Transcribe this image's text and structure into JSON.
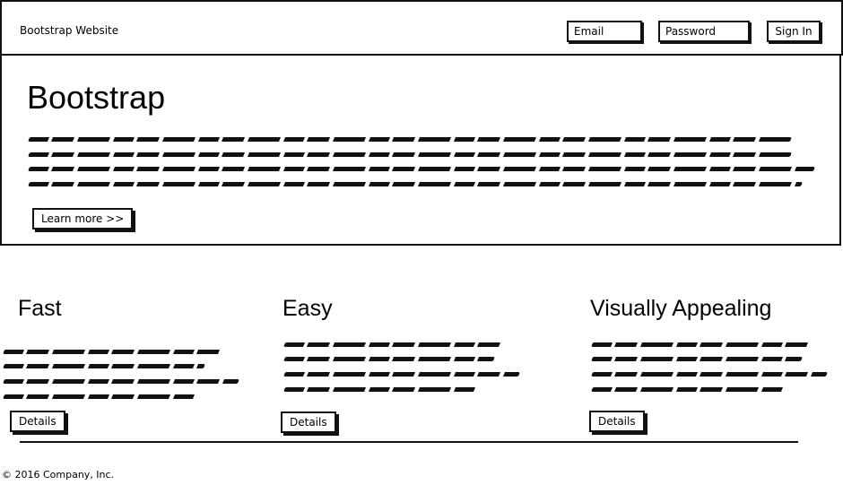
{
  "navbar": {
    "brand": "Bootstrap Website",
    "email_placeholder": "Email",
    "password_placeholder": "Password",
    "sign_in": "Sign In"
  },
  "hero": {
    "title": "Bootstrap",
    "button": "Learn more >>"
  },
  "columns": [
    {
      "title": "Fast",
      "button": "Details"
    },
    {
      "title": "Easy",
      "button": "Details"
    },
    {
      "title": "Visually Appealing",
      "button": "Details"
    }
  ],
  "footer": {
    "copyright": "© 2016 Company, Inc."
  }
}
